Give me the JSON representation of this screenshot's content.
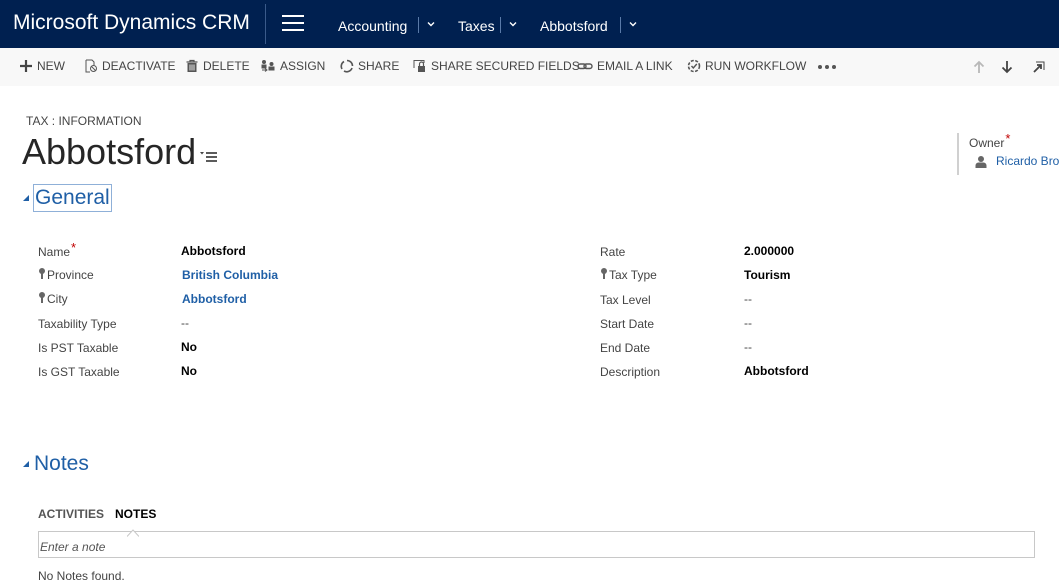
{
  "app": {
    "title": "Microsoft Dynamics CRM",
    "menu_icon": "hamburger-icon",
    "breadcrumbs": [
      {
        "label": "Accounting"
      },
      {
        "label": "Taxes"
      },
      {
        "label": "Abbotsford"
      }
    ]
  },
  "toolbar": {
    "commands": [
      {
        "label": "NEW",
        "icon": "plus-icon"
      },
      {
        "label": "DEACTIVATE",
        "icon": "deactivate-icon"
      },
      {
        "label": "DELETE",
        "icon": "trash-icon"
      },
      {
        "label": "ASSIGN",
        "icon": "assign-icon"
      },
      {
        "label": "SHARE",
        "icon": "share-icon"
      },
      {
        "label": "SHARE SECURED FIELDS",
        "icon": "secure-share-icon"
      },
      {
        "label": "EMAIL A LINK",
        "icon": "link-icon"
      },
      {
        "label": "RUN WORKFLOW",
        "icon": "workflow-icon"
      }
    ],
    "more_icon": "ellipsis-icon",
    "nav": [
      "arrow-up-icon",
      "arrow-down-icon",
      "expand-icon"
    ]
  },
  "header": {
    "entity_label": "TAX : INFORMATION",
    "record_title": "Abbotsford",
    "owner": {
      "label": "Owner",
      "required_mark": "*",
      "value": "Ricardo Bro"
    }
  },
  "sections": {
    "general": {
      "title": "General",
      "left_fields": [
        {
          "label": "Name",
          "required": "*",
          "value": "Abbotsford",
          "type": "text"
        },
        {
          "label": "Province",
          "value": "British Columbia",
          "type": "lookup"
        },
        {
          "label": "City",
          "value": "Abbotsford",
          "type": "lookup"
        },
        {
          "label": "Taxability Type",
          "value": "--",
          "type": "empty"
        },
        {
          "label": "Is PST Taxable",
          "value": "No",
          "type": "text"
        },
        {
          "label": "Is GST Taxable",
          "value": "No",
          "type": "text"
        }
      ],
      "right_fields": [
        {
          "label": "Rate",
          "value": "2.000000",
          "type": "text"
        },
        {
          "label": "Tax Type",
          "value": "Tourism",
          "type": "text"
        },
        {
          "label": "Tax Level",
          "value": "--",
          "type": "empty"
        },
        {
          "label": "Start Date",
          "value": "--",
          "type": "empty"
        },
        {
          "label": "End Date",
          "value": "--",
          "type": "empty"
        },
        {
          "label": "Description",
          "value": "Abbotsford",
          "type": "text"
        }
      ]
    },
    "notes": {
      "title": "Notes",
      "tabs": [
        {
          "label": "ACTIVITIES",
          "active": false
        },
        {
          "label": "NOTES",
          "active": true
        }
      ],
      "input_placeholder": "Enter a note",
      "empty_message": "No Notes found."
    }
  },
  "colors": {
    "nav_bg": "#002050",
    "accent_link": "#1f5fa6",
    "required": "#c00000",
    "command_bar_bg": "#f8f8f8"
  }
}
